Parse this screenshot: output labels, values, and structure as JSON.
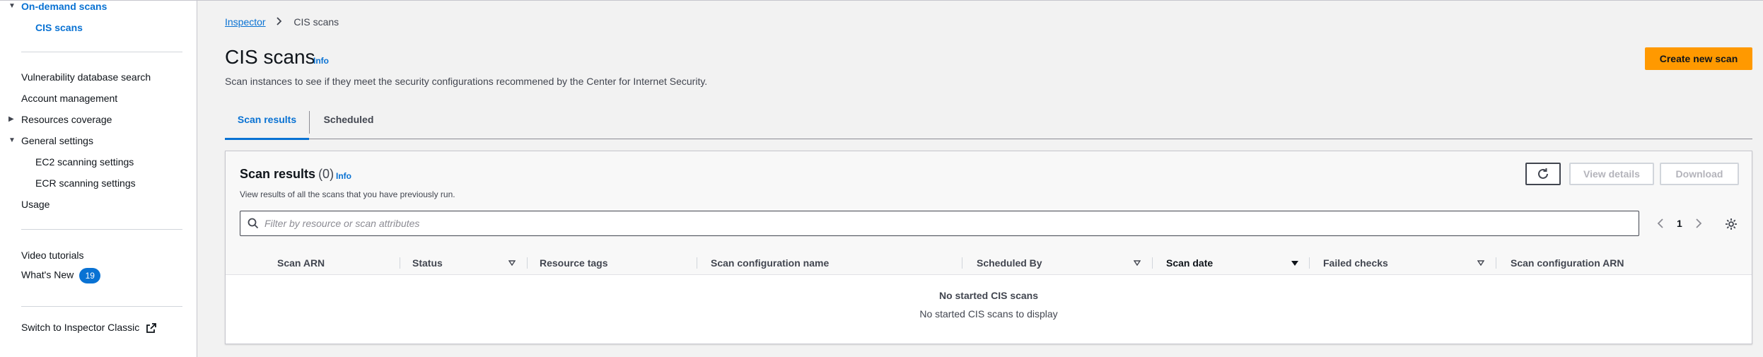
{
  "sidebar": {
    "on_demand_scans": "On-demand scans",
    "cis_scans": "CIS scans",
    "vuln_db_search": "Vulnerability database search",
    "account_management": "Account management",
    "resources_coverage": "Resources coverage",
    "general_settings": "General settings",
    "ec2_scanning_settings": "EC2 scanning settings",
    "ecr_scanning_settings": "ECR scanning settings",
    "usage": "Usage",
    "video_tutorials": "Video tutorials",
    "whats_new": "What's New",
    "whats_new_count": "19",
    "switch_classic": "Switch to Inspector Classic"
  },
  "breadcrumb": {
    "parent": "Inspector",
    "current": "CIS scans"
  },
  "header": {
    "title": "CIS scans",
    "info": "Info",
    "description": "Scan instances to see if they meet the security configurations recommened by the Center for Internet Security.",
    "create_button": "Create new scan"
  },
  "tabs": [
    {
      "label": "Scan results",
      "active": true
    },
    {
      "label": "Scheduled",
      "active": false
    }
  ],
  "panel": {
    "title": "Scan results",
    "count": "(0)",
    "info": "Info",
    "description": "View results of all the scans that you have previously run.",
    "view_details": "View details",
    "download": "Download",
    "search_placeholder": "Filter by resource or scan attributes",
    "page_number": "1"
  },
  "table": {
    "columns": [
      "Scan ARN",
      "Status",
      "Resource tags",
      "Scan configuration name",
      "Scheduled By",
      "Scan date",
      "Failed checks",
      "Scan configuration ARN"
    ],
    "empty_title": "No started CIS scans",
    "empty_desc": "No started CIS scans to display"
  },
  "colors": {
    "accent": "#0972d3",
    "primary_button": "#ff9900"
  }
}
